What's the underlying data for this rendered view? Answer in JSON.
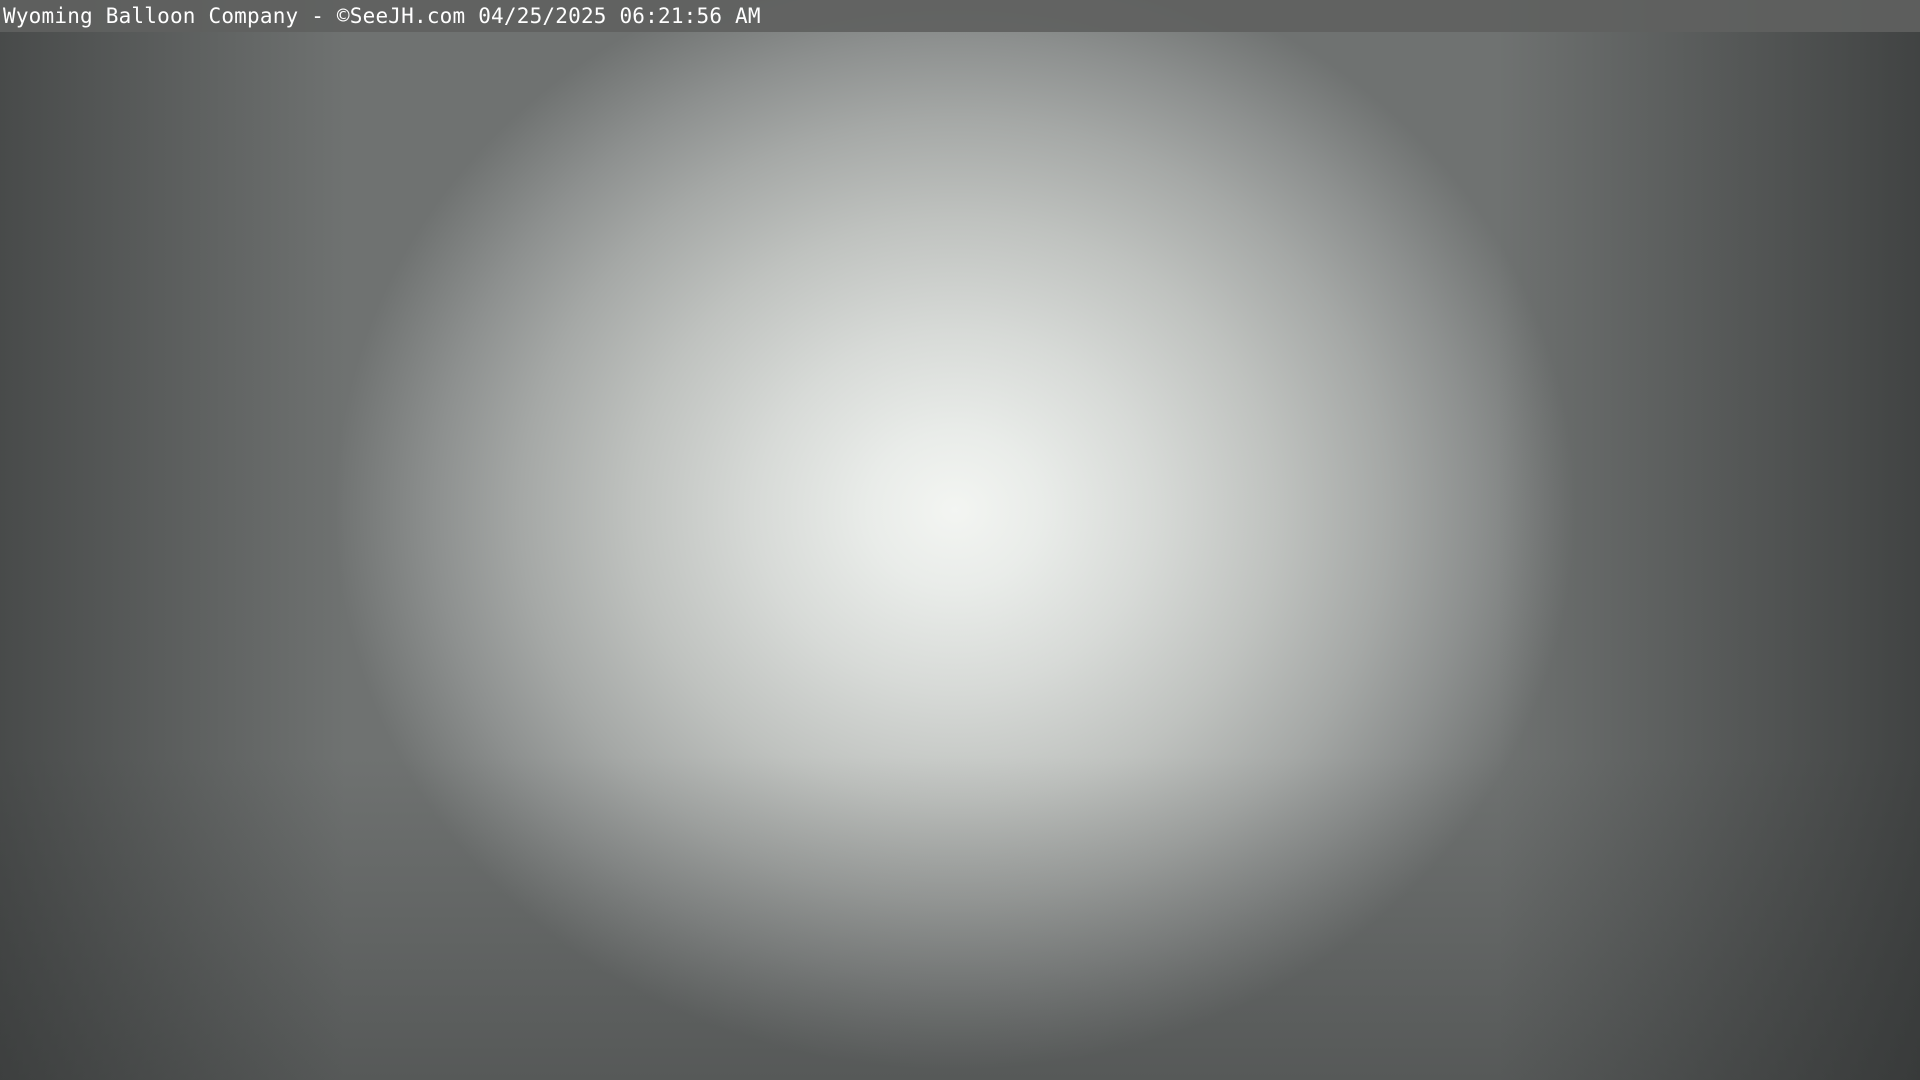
{
  "overlay": {
    "caption": "Wyoming Balloon Company - ©SeeJH.com 04/25/2025 06:21:56 AM"
  },
  "scene": {
    "description_colors": {
      "center_glow": "#f3f5f2",
      "edge": "#6f7271",
      "banner_bg": "#5f6160",
      "banner_text": "#ffffff"
    }
  }
}
